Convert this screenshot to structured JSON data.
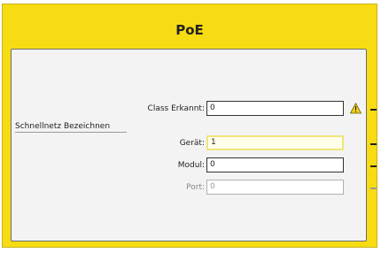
{
  "panel": {
    "title": "PoE"
  },
  "section": {
    "label": "Schnellnetz Bezeichnen"
  },
  "fields": {
    "class_detected": {
      "label": "Class Erkannt:",
      "value": "0"
    },
    "geraet": {
      "label": "Gerät:",
      "value": "1"
    },
    "modul": {
      "label": "Modul:",
      "value": "0"
    },
    "port": {
      "label": "Port:",
      "value": "0"
    }
  },
  "icons": {
    "warning": "warning-icon",
    "dash": "dash-icon"
  },
  "colors": {
    "panel_bg": "#f7dc13",
    "content_bg": "#f3f3f3",
    "warning": "#f1d21c"
  }
}
